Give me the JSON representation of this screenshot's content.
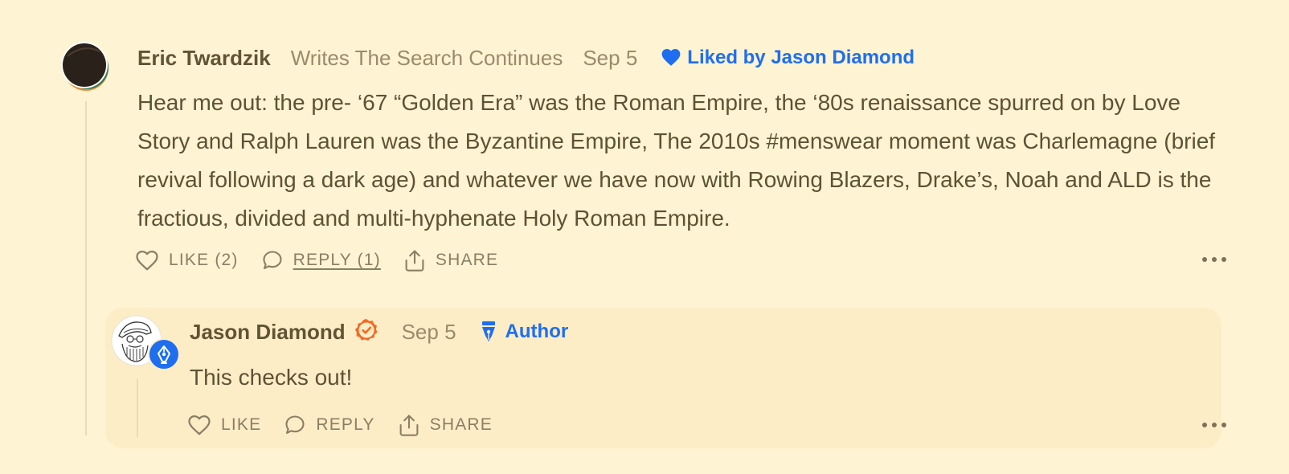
{
  "comment": {
    "author": "Eric Twardzik",
    "publication": "Writes The Search Continues",
    "date": "Sep 5",
    "liked_by": "Liked by Jason Diamond",
    "body": "Hear me out: the pre- ‘67 “Golden Era” was the Roman Empire, the ‘80s renaissance spurred on by Love Story and Ralph Lauren was the Byzantine Empire, The 2010s #menswear moment was Charlemagne (brief revival following a dark age) and whatever we have now with Rowing Blazers, Drake’s, Noah and ALD is the fractious, divided and multi-hyphenate Holy Roman Empire.",
    "actions": {
      "like": "LIKE (2)",
      "reply": "REPLY (1)",
      "share": "SHARE"
    },
    "icons": {
      "avatar": "avatar-dark-circle-icon",
      "liked": "heart-filled-icon",
      "like": "heart-outline-icon",
      "reply": "speech-bubble-icon",
      "share": "share-upload-icon",
      "more": "more-dots-icon"
    }
  },
  "reply": {
    "author": "Jason Diamond",
    "date": "Sep 5",
    "tag": "Author",
    "body": "This checks out!",
    "actions": {
      "like": "LIKE",
      "reply": "REPLY",
      "share": "SHARE"
    },
    "icons": {
      "avatar": "sketch-portrait-avatar",
      "badge": "fountain-pen-badge-icon",
      "verified": "verified-check-icon",
      "tag": "fountain-pen-icon"
    }
  },
  "colors": {
    "background": "#fef3d2",
    "reply_card": "#fdedc7",
    "accent_blue": "#1f6ef0",
    "verified_orange": "#f26a25",
    "text": "#5e5235",
    "muted": "#9a8c6b"
  }
}
